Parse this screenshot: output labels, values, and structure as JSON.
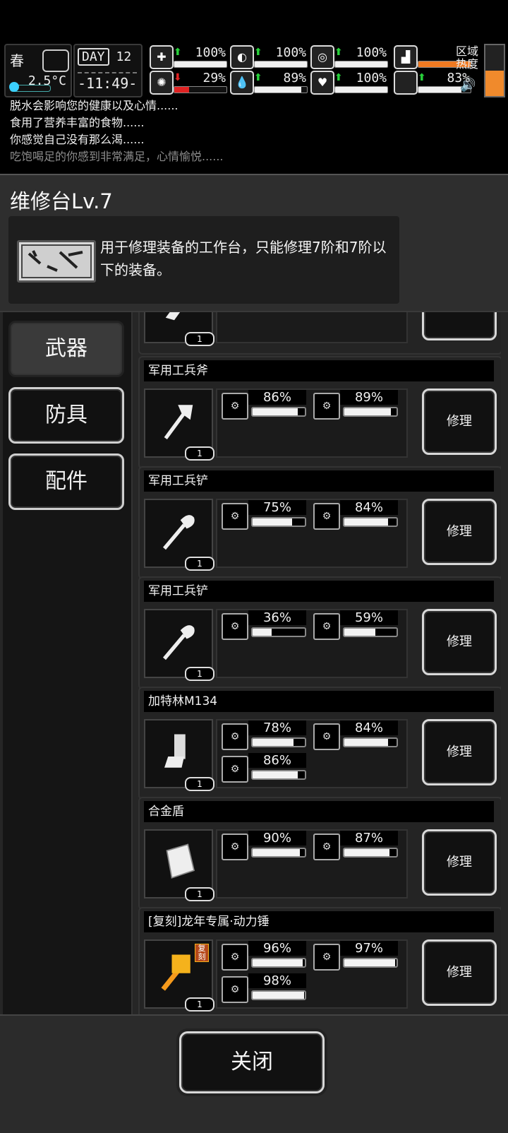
{
  "status": {
    "season": "春",
    "temperature": "2.5°C",
    "day_label": "DAY",
    "day_number": "12",
    "clock": "-11:49-",
    "stats": [
      {
        "icon": "medkit-icon",
        "glyph": "✚",
        "arrow": "up",
        "value": "100%",
        "level": 1.0,
        "fill_color": "#f0f0f0"
      },
      {
        "icon": "stomach-icon",
        "glyph": "◐",
        "arrow": "up",
        "value": "100%",
        "level": 1.0,
        "fill_color": "#f0f0f0"
      },
      {
        "icon": "pill-icon",
        "glyph": "◎",
        "arrow": "up",
        "value": "100%",
        "level": 1.0,
        "fill_color": "#f0f0f0"
      },
      {
        "icon": "brain-icon",
        "glyph": "✺",
        "arrow": "down",
        "value": "29%",
        "level": 0.29,
        "fill_color": "#e02222"
      },
      {
        "icon": "water-drop-icon",
        "glyph": "💧",
        "arrow": "up",
        "value": "89%",
        "level": 0.89,
        "fill_color": "#f0f0f0"
      },
      {
        "icon": "heart-icon",
        "glyph": "♥",
        "arrow": "up",
        "value": "100%",
        "level": 1.0,
        "fill_color": "#f0f0f0"
      },
      {
        "icon": "boot-icon",
        "glyph": "▟",
        "arrow": "",
        "value": "",
        "level": 1.0,
        "fill_color": "#f07a22"
      },
      {
        "icon": "stamina-icon",
        "glyph": "",
        "arrow": "up",
        "value": "83%",
        "level": 0.83,
        "fill_color": "#f0f0f0"
      }
    ],
    "zone_label": "区域\n热度",
    "zone_heat_level": 0.5
  },
  "log": [
    "脱水会影响您的健康以及心情......",
    "食用了营养丰富的食物......",
    "你感觉自己没有那么渴......",
    "吃饱喝足的你感到非常满足，心情愉悦......"
  ],
  "panel": {
    "title": "维修台Lv.7",
    "description": "用于修理装备的工作台，只能修理7阶和7阶以下的装备。"
  },
  "tabs": [
    {
      "label": "武器",
      "active": true
    },
    {
      "label": "防具",
      "active": false
    },
    {
      "label": "配件",
      "active": false
    }
  ],
  "items": [
    {
      "name": "",
      "count": "1",
      "icon": "weapon-icon",
      "attrs": [],
      "partial": true
    },
    {
      "name": "军用工兵斧",
      "count": "1",
      "icon": "axe-icon",
      "attrs": [
        {
          "icon": "gun-part-icon",
          "value": "86%",
          "level": 0.86
        },
        {
          "icon": "blade-icon",
          "value": "89%",
          "level": 0.89
        }
      ]
    },
    {
      "name": "军用工兵铲",
      "count": "1",
      "icon": "shovel-icon",
      "attrs": [
        {
          "icon": "gear-part-icon",
          "value": "75%",
          "level": 0.75
        },
        {
          "icon": "blade-icon",
          "value": "84%",
          "level": 0.84
        }
      ]
    },
    {
      "name": "军用工兵铲",
      "count": "1",
      "icon": "shovel-icon",
      "attrs": [
        {
          "icon": "gear-part-icon",
          "value": "36%",
          "level": 0.36
        },
        {
          "icon": "blade-icon",
          "value": "59%",
          "level": 0.59
        }
      ]
    },
    {
      "name": "加特林M134",
      "count": "1",
      "icon": "gatling-icon",
      "attrs": [
        {
          "icon": "gun-part-icon",
          "value": "78%",
          "level": 0.78
        },
        {
          "icon": "barrel-icon",
          "value": "84%",
          "level": 0.84
        },
        {
          "icon": "trigger-icon",
          "value": "86%",
          "level": 0.86
        }
      ]
    },
    {
      "name": "合金盾",
      "count": "1",
      "icon": "shield-icon",
      "attrs": [
        {
          "icon": "plate-icon",
          "value": "90%",
          "level": 0.9
        },
        {
          "icon": "strap-icon",
          "value": "87%",
          "level": 0.87
        }
      ]
    },
    {
      "name": "[复刻]龙年专属·动力锤",
      "count": "1",
      "icon": "power-hammer-icon",
      "badge": "复刻",
      "attrs": [
        {
          "icon": "hammer-head-icon",
          "value": "96%",
          "level": 0.96
        },
        {
          "icon": "handle-icon",
          "value": "97%",
          "level": 0.97
        },
        {
          "icon": "engine-icon",
          "value": "98%",
          "level": 0.98
        }
      ]
    }
  ],
  "repair_label": "修理",
  "close_label": "关闭"
}
